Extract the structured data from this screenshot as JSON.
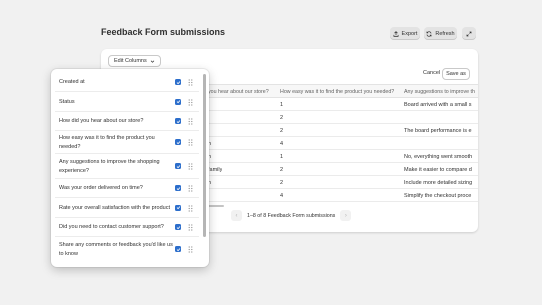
{
  "page": {
    "title": "Feedback Form submissions"
  },
  "header": {
    "export_label": "Export",
    "refresh_label": "Refresh"
  },
  "toolbar": {
    "edit_columns_label": "Edit Columns",
    "cancel_label": "Cancel",
    "save_label": "Save as"
  },
  "table": {
    "columns": [
      "you hear about our store?",
      "How easy was it to find the product you needed?",
      "Any suggestions to improve th"
    ],
    "rows": [
      [
        "",
        "1",
        "Board arrived with a small s"
      ],
      [
        "",
        "2",
        ""
      ],
      [
        "",
        "2",
        "The board performance is e"
      ],
      [
        "n",
        "4",
        ""
      ],
      [
        "n",
        "1",
        "No, everything went smooth"
      ],
      [
        "family",
        "2",
        "Make it easier to compare d"
      ],
      [
        "n",
        "2",
        "Include more detailed sizing"
      ],
      [
        "",
        "4",
        "Simplify the checkout proce"
      ]
    ]
  },
  "pagination": {
    "text": "1–8 of 8 Feedback Form submissions",
    "prev": "‹",
    "next": "›"
  },
  "column_options": [
    {
      "label": "Created at",
      "checked": true
    },
    {
      "label": "Status",
      "checked": true
    },
    {
      "label": "How did you hear about our store?",
      "checked": true
    },
    {
      "label": "How easy was it to find the product you needed?",
      "checked": true
    },
    {
      "label": "Any suggestions to improve the shopping experience?",
      "checked": true
    },
    {
      "label": "Was your order delivered on time?",
      "checked": true
    },
    {
      "label": "Rate your overall satisfaction with the product",
      "checked": true
    },
    {
      "label": "Did you need to contact customer support?",
      "checked": true
    },
    {
      "label": "Share any comments or feedback you'd like us to know",
      "checked": true
    }
  ],
  "colors": {
    "accent": "#2c6ecb",
    "background": "#f1f1f1",
    "text": "#303030"
  },
  "icons": {
    "export": "export-icon",
    "refresh": "refresh-icon",
    "expand": "expand-icon",
    "chevron": "chevron-down-icon",
    "drag": "drag-handle-icon",
    "check": "check-icon"
  }
}
